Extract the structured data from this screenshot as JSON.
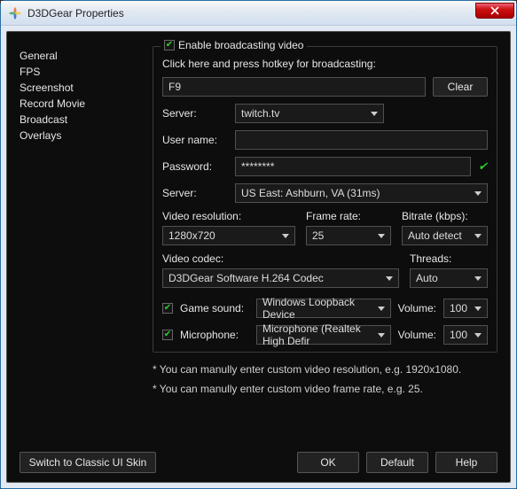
{
  "window": {
    "title": "D3DGear Properties"
  },
  "sidebar": {
    "items": [
      "General",
      "FPS",
      "Screenshot",
      "Record Movie",
      "Broadcast",
      "Overlays"
    ]
  },
  "broadcast": {
    "enable_label": "Enable broadcasting video",
    "hotkey_prompt": "Click here and press hotkey for broadcasting:",
    "hotkey_value": "F9",
    "clear_label": "Clear",
    "server_label": "Server:",
    "server_value": "twitch.tv",
    "username_label": "User name:",
    "username_value": "         ",
    "password_label": "Password:",
    "password_value": "********",
    "server2_label": "Server:",
    "server2_value": "US East: Ashburn, VA    (31ms)",
    "resolution_label": "Video resolution:",
    "resolution_value": "1280x720",
    "framerate_label": "Frame rate:",
    "framerate_value": "25",
    "bitrate_label": "Bitrate (kbps):",
    "bitrate_value": "Auto detect",
    "codec_label": "Video codec:",
    "codec_value": "D3DGear Software H.264 Codec",
    "threads_label": "Threads:",
    "threads_value": "Auto",
    "gamesound_label": "Game sound:",
    "gamesound_value": "Windows Loopback Device",
    "mic_label": "Microphone:",
    "mic_value": "Microphone (Realtek High Defir",
    "volume_label": "Volume:",
    "volume_game": "100",
    "volume_mic": "100",
    "note1": "* You can manully enter custom video resolution, e.g. 1920x1080.",
    "note2": "* You can manully enter custom video frame rate, e.g. 25."
  },
  "footer": {
    "switch_label": "Switch to Classic UI Skin",
    "ok": "OK",
    "default": "Default",
    "help": "Help"
  }
}
